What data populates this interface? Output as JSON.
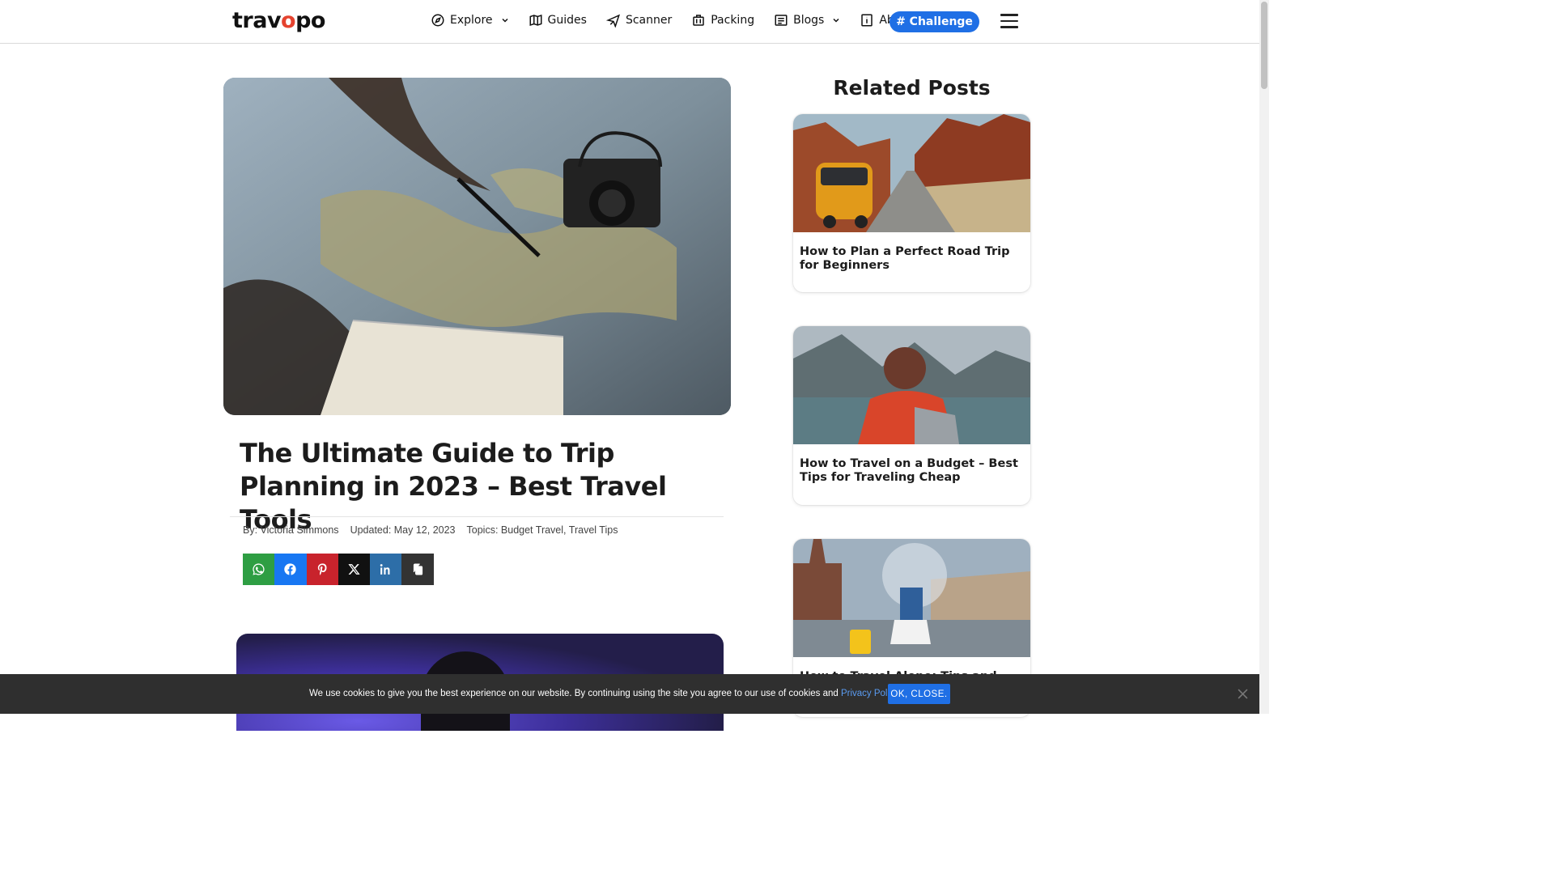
{
  "header": {
    "logo": {
      "prefix": "trav",
      "o": "o",
      "suffix": "po"
    },
    "nav": [
      {
        "label": "Explore",
        "icon": "compass-icon",
        "dropdown": true
      },
      {
        "label": "Guides",
        "icon": "map-icon",
        "dropdown": false
      },
      {
        "label": "Scanner",
        "icon": "plane-icon",
        "dropdown": false
      },
      {
        "label": "Packing",
        "icon": "luggage-icon",
        "dropdown": false
      },
      {
        "label": "Blogs",
        "icon": "list-icon",
        "dropdown": true
      },
      {
        "label": "About",
        "icon": "info-icon",
        "dropdown": false
      }
    ],
    "challenge_label": "# Challenge"
  },
  "article": {
    "title": "The Ultimate Guide to Trip Planning in 2023 – Best Travel Tools",
    "author": "By: Victoria Simmons",
    "updated": "Updated: May 12, 2023",
    "topics_prefix": "Topics:",
    "topics": [
      "Budget Travel",
      "Travel Tips"
    ]
  },
  "share": [
    {
      "name": "whatsapp",
      "icon": "whatsapp-icon",
      "color": "#2e9e43"
    },
    {
      "name": "facebook",
      "icon": "facebook-icon",
      "color": "#1877f2"
    },
    {
      "name": "pinterest",
      "icon": "pinterest-icon",
      "color": "#c8232c"
    },
    {
      "name": "x",
      "icon": "x-icon",
      "color": "#111111"
    },
    {
      "name": "linkedin",
      "icon": "linkedin-icon",
      "color": "#2d6ea8"
    },
    {
      "name": "copy",
      "icon": "copy-icon",
      "color": "#333333"
    }
  ],
  "related": {
    "heading": "Related Posts",
    "posts": [
      {
        "title": "How to Plan a Perfect Road Trip for Beginners"
      },
      {
        "title": "How to Travel on a Budget – Best Tips for Traveling Cheap"
      },
      {
        "title": "How to Travel Alone: Tips and Hacks f"
      }
    ]
  },
  "cookie": {
    "text": "We use cookies to give you the best experience on our website. By continuing using the site you agree to our use of cookies and ",
    "link": "Privacy Policy",
    "after": ".",
    "ok_label": "OK, CLOSE."
  },
  "colors": {
    "accent": "#1f6fe5",
    "cookie_bg": "#2f2f2f"
  }
}
